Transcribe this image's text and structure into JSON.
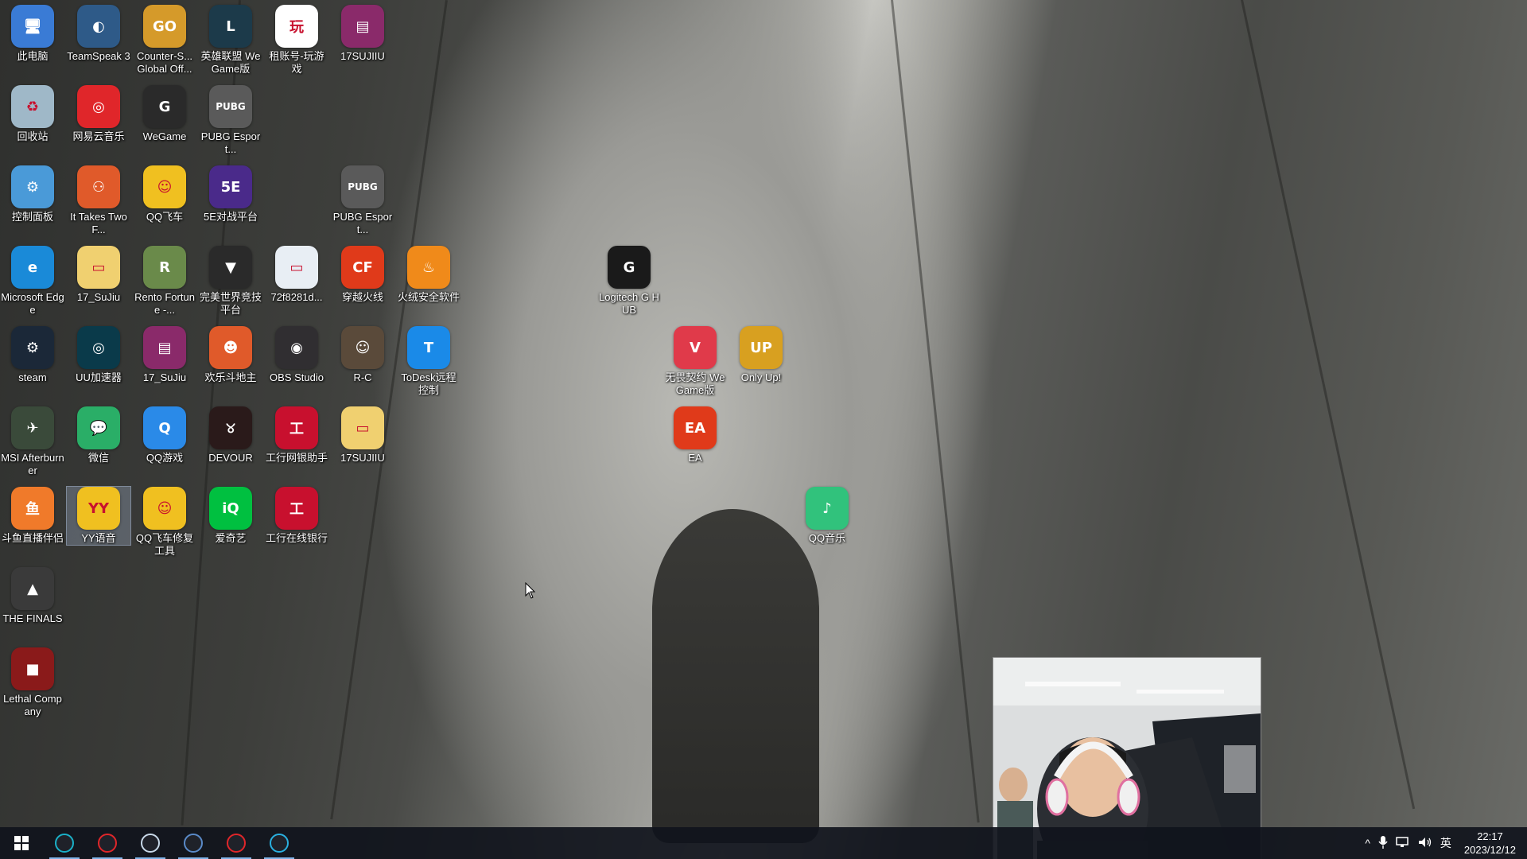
{
  "desktop": {
    "icons": [
      {
        "label": "此电脑",
        "icon": "computer-icon",
        "color": "#3a7bd5"
      },
      {
        "label": "TeamSpeak 3",
        "icon": "teamspeak-icon",
        "color": "#2e5a88"
      },
      {
        "label": "Counter-S... Global Off...",
        "icon": "csgo-icon",
        "color": "#d59a2a"
      },
      {
        "label": "英雄联盟 WeGame版",
        "icon": "lol-icon",
        "color": "#1c3a4a"
      },
      {
        "label": "租账号-玩游戏",
        "icon": "rent-account-icon",
        "color": "#ffffff"
      },
      {
        "label": "17SUJIIU",
        "icon": "winrar-icon",
        "color": "#8a2a6a"
      },
      {
        "label": "回收站",
        "icon": "recycle-bin-icon",
        "color": "#9fb8c8"
      },
      {
        "label": "网易云音乐",
        "icon": "netease-music-icon",
        "color": "#e0262a"
      },
      {
        "label": "WeGame",
        "icon": "wegame-icon",
        "color": "#2a2a2a"
      },
      {
        "label": "PUBG Esport...",
        "icon": "pubg-icon",
        "color": "#5a5a5a"
      },
      {
        "label": "控制面板",
        "icon": "control-panel-icon",
        "color": "#4a9ad8"
      },
      {
        "label": "It Takes Two F...",
        "icon": "it-takes-two-icon",
        "color": "#e05a2a"
      },
      {
        "label": "QQ飞车",
        "icon": "qq-speed-icon",
        "color": "#f0c020"
      },
      {
        "label": "5E对战平台",
        "icon": "5e-platform-icon",
        "color": "#4a2a8a"
      },
      {
        "label": "PUBG Esport...",
        "icon": "pubg-icon",
        "color": "#5a5a5a"
      },
      {
        "label": "Microsoft Edge",
        "icon": "edge-icon",
        "color": "#1a8ad8"
      },
      {
        "label": "17_SuJiu",
        "icon": "folder-icon",
        "color": "#f0d070"
      },
      {
        "label": "Rento Fortune -...",
        "icon": "rento-icon",
        "color": "#6a8a4a"
      },
      {
        "label": "完美世界竞技平台",
        "icon": "perfect-world-icon",
        "color": "#2a2a2a"
      },
      {
        "label": "72f8281d...",
        "icon": "image-file-icon",
        "color": "#e8eef4"
      },
      {
        "label": "穿越火线",
        "icon": "crossfire-icon",
        "color": "#e03a1a"
      },
      {
        "label": "火绒安全软件",
        "icon": "huorong-icon",
        "color": "#f08a1a"
      },
      {
        "label": "Logitech G HUB",
        "icon": "logitech-ghub-icon",
        "color": "#1a1a1a"
      },
      {
        "label": "steam",
        "icon": "steam-icon",
        "color": "#1b2838"
      },
      {
        "label": "UU加速器",
        "icon": "uu-accelerator-icon",
        "color": "#0a3a4a"
      },
      {
        "label": "17_SuJiu",
        "icon": "winrar-icon",
        "color": "#8a2a6a"
      },
      {
        "label": "欢乐斗地主",
        "icon": "doudizhu-icon",
        "color": "#e05a2a"
      },
      {
        "label": "OBS Studio",
        "icon": "obs-icon",
        "color": "#302e31"
      },
      {
        "label": "R-C",
        "icon": "photo-icon",
        "color": "#5a4a3a"
      },
      {
        "label": "ToDesk远程控制",
        "icon": "todesk-icon",
        "color": "#1a8ae8"
      },
      {
        "label": "无畏契约 WeGame版",
        "icon": "valorant-icon",
        "color": "#e03a4a"
      },
      {
        "label": "Only Up!",
        "icon": "only-up-icon",
        "color": "#d8a020"
      },
      {
        "label": "MSI Afterburner",
        "icon": "msi-afterburner-icon",
        "color": "#3a4a3a"
      },
      {
        "label": "微信",
        "icon": "wechat-icon",
        "color": "#2aae67"
      },
      {
        "label": "QQ游戏",
        "icon": "qq-game-icon",
        "color": "#2a8ae8"
      },
      {
        "label": "DEVOUR",
        "icon": "devour-icon",
        "color": "#2a1a1a"
      },
      {
        "label": "工行网银助手",
        "icon": "icbc-icon",
        "color": "#c8102e"
      },
      {
        "label": "17SUJIIU",
        "icon": "folder-icon",
        "color": "#f0d070"
      },
      {
        "label": "EA",
        "icon": "ea-icon",
        "color": "#e03a1a"
      },
      {
        "label": "斗鱼直播伴侣",
        "icon": "douyu-icon",
        "color": "#f07a2a"
      },
      {
        "label": "YY语音",
        "icon": "yy-voice-icon",
        "color": "#f0c020"
      },
      {
        "label": "QQ飞车修复工具",
        "icon": "qq-speed-repair-icon",
        "color": "#f0c020"
      },
      {
        "label": "爱奇艺",
        "icon": "iqiyi-icon",
        "color": "#00c040"
      },
      {
        "label": "工行在线银行",
        "icon": "icbc-online-icon",
        "color": "#c8102e"
      },
      {
        "label": "QQ音乐",
        "icon": "qq-music-icon",
        "color": "#31c27c"
      },
      {
        "label": "THE FINALS",
        "icon": "the-finals-icon",
        "color": "#3a3a3a"
      },
      {
        "label": "Lethal Company",
        "icon": "lethal-company-icon",
        "color": "#8a1a1a"
      }
    ]
  },
  "taskbar": {
    "start_icon": "windows-start-icon",
    "apps": [
      {
        "icon": "uu-accelerator-icon",
        "color": "#1ab0c8"
      },
      {
        "icon": "obs-recording-icon",
        "color": "#e0262a"
      },
      {
        "icon": "steam-icon",
        "color": "#c8d8e8"
      },
      {
        "icon": "teamspeak-icon",
        "color": "#5a8ac8"
      },
      {
        "icon": "netease-music-icon",
        "color": "#e0262a"
      },
      {
        "icon": "edge-icon",
        "color": "#2ab0e0"
      }
    ],
    "tray": {
      "chevron": "^",
      "ime": "英",
      "time": "22:17",
      "date": "2023/12/12"
    }
  },
  "webcam": {
    "visible": true
  }
}
